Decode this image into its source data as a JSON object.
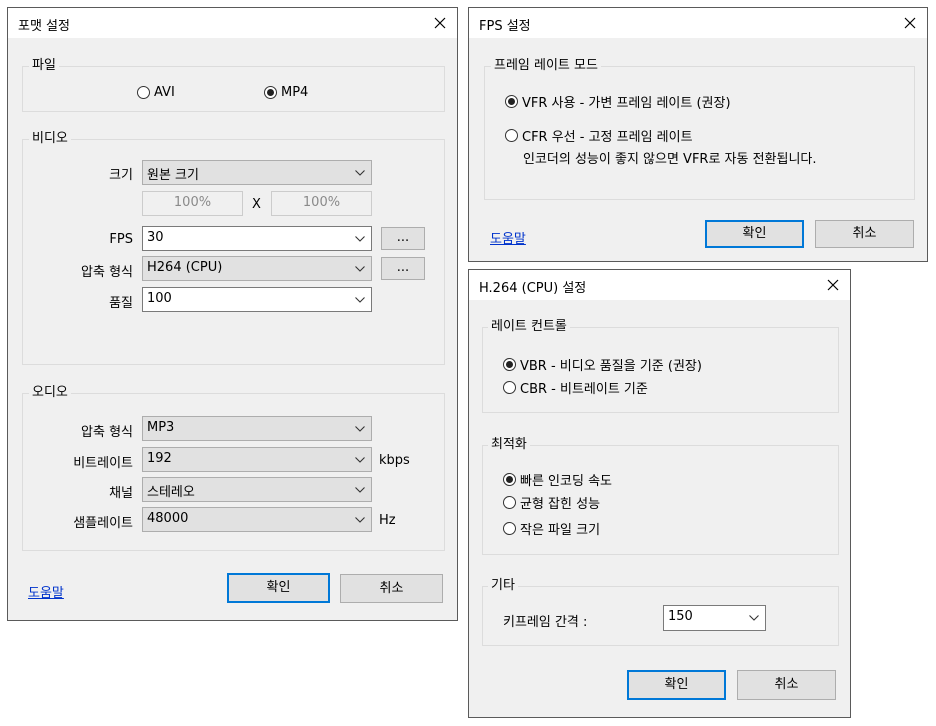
{
  "format_dialog": {
    "title": "포맷 설정",
    "file_group": {
      "label": "파일",
      "options": [
        {
          "label": "AVI",
          "selected": false
        },
        {
          "label": "MP4",
          "selected": true
        }
      ]
    },
    "video_group": {
      "label": "비디오",
      "size_label": "크기",
      "size_value": "원본 크기",
      "width_pct": "100%",
      "times": "X",
      "height_pct": "100%",
      "fps_label": "FPS",
      "fps_value": "30",
      "codec_label": "압축 형식",
      "codec_value": "H264 (CPU)",
      "quality_label": "품질",
      "quality_value": "100",
      "more_button": "..."
    },
    "audio_group": {
      "label": "오디오",
      "codec_label": "압축 형식",
      "codec_value": "MP3",
      "bitrate_label": "비트레이트",
      "bitrate_value": "192",
      "bitrate_unit": "kbps",
      "channel_label": "채널",
      "channel_value": "스테레오",
      "samplerate_label": "샘플레이트",
      "samplerate_value": "48000",
      "samplerate_unit": "Hz"
    },
    "help": "도움말",
    "ok": "확인",
    "cancel": "취소"
  },
  "fps_dialog": {
    "title": "FPS 설정",
    "group_label": "프레임 레이트 모드",
    "vfr_label": "VFR 사용 - 가변 프레임 레이트 (권장)",
    "vfr_selected": true,
    "cfr_label": "CFR 우선 - 고정 프레임 레이트",
    "cfr_selected": false,
    "cfr_note": "인코더의 성능이 좋지 않으면 VFR로 자동 전환됩니다.",
    "help": "도움말",
    "ok": "확인",
    "cancel": "취소"
  },
  "h264_dialog": {
    "title": "H.264 (CPU) 설정",
    "rate_group": {
      "label": "레이트 컨트롤",
      "options": [
        {
          "label": "VBR - 비디오 품질을 기준 (권장)",
          "selected": true
        },
        {
          "label": "CBR - 비트레이트 기준",
          "selected": false
        }
      ]
    },
    "opt_group": {
      "label": "최적화",
      "options": [
        {
          "label": "빠른 인코딩 속도",
          "selected": true
        },
        {
          "label": "균형 잡힌 성능",
          "selected": false
        },
        {
          "label": "작은 파일 크기",
          "selected": false
        }
      ]
    },
    "misc_group": {
      "label": "기타",
      "keyframe_label": "키프레임 간격 :",
      "keyframe_value": "150"
    },
    "ok": "확인",
    "cancel": "취소"
  }
}
